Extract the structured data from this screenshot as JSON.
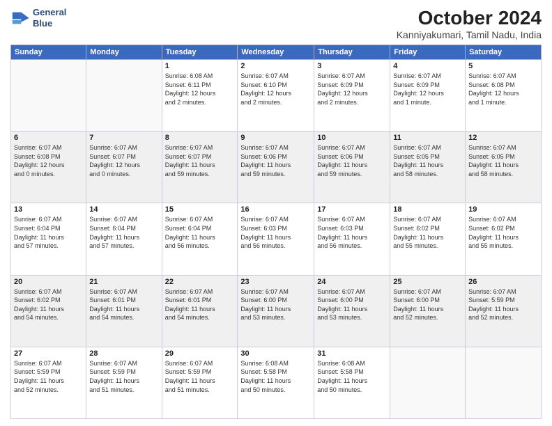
{
  "header": {
    "logo_line1": "General",
    "logo_line2": "Blue",
    "month_title": "October 2024",
    "location": "Kanniyakumari, Tamil Nadu, India"
  },
  "days_of_week": [
    "Sunday",
    "Monday",
    "Tuesday",
    "Wednesday",
    "Thursday",
    "Friday",
    "Saturday"
  ],
  "rows": [
    {
      "shaded": false,
      "cells": [
        {
          "day": "",
          "content": ""
        },
        {
          "day": "",
          "content": ""
        },
        {
          "day": "1",
          "content": "Sunrise: 6:08 AM\nSunset: 6:11 PM\nDaylight: 12 hours\nand 2 minutes."
        },
        {
          "day": "2",
          "content": "Sunrise: 6:07 AM\nSunset: 6:10 PM\nDaylight: 12 hours\nand 2 minutes."
        },
        {
          "day": "3",
          "content": "Sunrise: 6:07 AM\nSunset: 6:09 PM\nDaylight: 12 hours\nand 2 minutes."
        },
        {
          "day": "4",
          "content": "Sunrise: 6:07 AM\nSunset: 6:09 PM\nDaylight: 12 hours\nand 1 minute."
        },
        {
          "day": "5",
          "content": "Sunrise: 6:07 AM\nSunset: 6:08 PM\nDaylight: 12 hours\nand 1 minute."
        }
      ]
    },
    {
      "shaded": true,
      "cells": [
        {
          "day": "6",
          "content": "Sunrise: 6:07 AM\nSunset: 6:08 PM\nDaylight: 12 hours\nand 0 minutes."
        },
        {
          "day": "7",
          "content": "Sunrise: 6:07 AM\nSunset: 6:07 PM\nDaylight: 12 hours\nand 0 minutes."
        },
        {
          "day": "8",
          "content": "Sunrise: 6:07 AM\nSunset: 6:07 PM\nDaylight: 11 hours\nand 59 minutes."
        },
        {
          "day": "9",
          "content": "Sunrise: 6:07 AM\nSunset: 6:06 PM\nDaylight: 11 hours\nand 59 minutes."
        },
        {
          "day": "10",
          "content": "Sunrise: 6:07 AM\nSunset: 6:06 PM\nDaylight: 11 hours\nand 59 minutes."
        },
        {
          "day": "11",
          "content": "Sunrise: 6:07 AM\nSunset: 6:05 PM\nDaylight: 11 hours\nand 58 minutes."
        },
        {
          "day": "12",
          "content": "Sunrise: 6:07 AM\nSunset: 6:05 PM\nDaylight: 11 hours\nand 58 minutes."
        }
      ]
    },
    {
      "shaded": false,
      "cells": [
        {
          "day": "13",
          "content": "Sunrise: 6:07 AM\nSunset: 6:04 PM\nDaylight: 11 hours\nand 57 minutes."
        },
        {
          "day": "14",
          "content": "Sunrise: 6:07 AM\nSunset: 6:04 PM\nDaylight: 11 hours\nand 57 minutes."
        },
        {
          "day": "15",
          "content": "Sunrise: 6:07 AM\nSunset: 6:04 PM\nDaylight: 11 hours\nand 56 minutes."
        },
        {
          "day": "16",
          "content": "Sunrise: 6:07 AM\nSunset: 6:03 PM\nDaylight: 11 hours\nand 56 minutes."
        },
        {
          "day": "17",
          "content": "Sunrise: 6:07 AM\nSunset: 6:03 PM\nDaylight: 11 hours\nand 56 minutes."
        },
        {
          "day": "18",
          "content": "Sunrise: 6:07 AM\nSunset: 6:02 PM\nDaylight: 11 hours\nand 55 minutes."
        },
        {
          "day": "19",
          "content": "Sunrise: 6:07 AM\nSunset: 6:02 PM\nDaylight: 11 hours\nand 55 minutes."
        }
      ]
    },
    {
      "shaded": true,
      "cells": [
        {
          "day": "20",
          "content": "Sunrise: 6:07 AM\nSunset: 6:02 PM\nDaylight: 11 hours\nand 54 minutes."
        },
        {
          "day": "21",
          "content": "Sunrise: 6:07 AM\nSunset: 6:01 PM\nDaylight: 11 hours\nand 54 minutes."
        },
        {
          "day": "22",
          "content": "Sunrise: 6:07 AM\nSunset: 6:01 PM\nDaylight: 11 hours\nand 54 minutes."
        },
        {
          "day": "23",
          "content": "Sunrise: 6:07 AM\nSunset: 6:00 PM\nDaylight: 11 hours\nand 53 minutes."
        },
        {
          "day": "24",
          "content": "Sunrise: 6:07 AM\nSunset: 6:00 PM\nDaylight: 11 hours\nand 53 minutes."
        },
        {
          "day": "25",
          "content": "Sunrise: 6:07 AM\nSunset: 6:00 PM\nDaylight: 11 hours\nand 52 minutes."
        },
        {
          "day": "26",
          "content": "Sunrise: 6:07 AM\nSunset: 5:59 PM\nDaylight: 11 hours\nand 52 minutes."
        }
      ]
    },
    {
      "shaded": false,
      "cells": [
        {
          "day": "27",
          "content": "Sunrise: 6:07 AM\nSunset: 5:59 PM\nDaylight: 11 hours\nand 52 minutes."
        },
        {
          "day": "28",
          "content": "Sunrise: 6:07 AM\nSunset: 5:59 PM\nDaylight: 11 hours\nand 51 minutes."
        },
        {
          "day": "29",
          "content": "Sunrise: 6:07 AM\nSunset: 5:59 PM\nDaylight: 11 hours\nand 51 minutes."
        },
        {
          "day": "30",
          "content": "Sunrise: 6:08 AM\nSunset: 5:58 PM\nDaylight: 11 hours\nand 50 minutes."
        },
        {
          "day": "31",
          "content": "Sunrise: 6:08 AM\nSunset: 5:58 PM\nDaylight: 11 hours\nand 50 minutes."
        },
        {
          "day": "",
          "content": ""
        },
        {
          "day": "",
          "content": ""
        }
      ]
    }
  ]
}
